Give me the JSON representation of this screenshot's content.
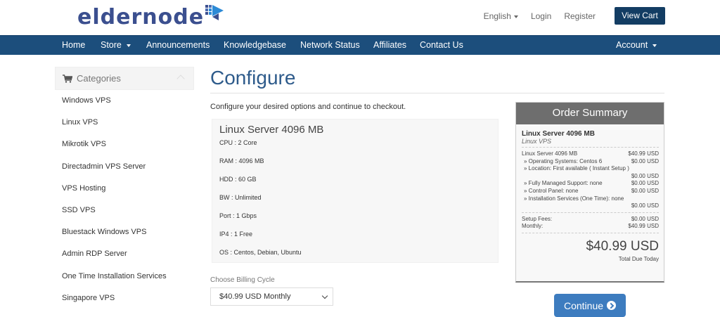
{
  "brand": {
    "logo_text": "eldernode"
  },
  "header": {
    "language": "English",
    "login": "Login",
    "register": "Register",
    "view_cart": "View Cart"
  },
  "nav": {
    "items": [
      "Home",
      "Store",
      "Announcements",
      "Knowledgebase",
      "Network Status",
      "Affiliates",
      "Contact Us"
    ],
    "account": "Account"
  },
  "sidebar": {
    "heading": "Categories",
    "items": [
      "Windows VPS",
      "Linux VPS",
      "Mikrotik VPS",
      "Directadmin VPS Server",
      "VPS Hosting",
      "SSD VPS",
      "Bluestack Windows VPS",
      "Admin RDP Server",
      "One Time Installation Services",
      "Singapore VPS"
    ]
  },
  "main": {
    "title": "Configure",
    "intro": "Configure your desired options and continue to checkout.",
    "product": {
      "name": "Linux Server 4096 MB",
      "specs": [
        "CPU : 2 Core",
        "RAM : 4096 MB",
        "HDD : 60 GB",
        "BW : Unlimited",
        "Port : 1 Gbps",
        "IP4 : 1 Free",
        "OS : Centos, Debian, Ubuntu"
      ]
    },
    "billing": {
      "label": "Choose Billing Cycle",
      "selected": "$40.99 USD Monthly"
    }
  },
  "summary": {
    "heading": "Order Summary",
    "product": "Linux Server 4096 MB",
    "group": "Linux VPS",
    "base": {
      "label": "Linux Server 4096 MB",
      "value": "$40.99 USD"
    },
    "os": {
      "label": "» Operating Systems: Centos 6",
      "value": "$0.00 USD"
    },
    "location": {
      "label": "» Location: First available ( Instant Setup )",
      "value": "$0.00 USD"
    },
    "managed": {
      "label": "» Fully Managed Support: none",
      "value": "$0.00 USD"
    },
    "panel": {
      "label": "» Control Panel: none",
      "value": "$0.00 USD"
    },
    "install": {
      "label": "» Installation Services (One Time): none",
      "value": "$0.00 USD"
    },
    "setup": {
      "label": "Setup Fees:",
      "value": "$0.00 USD"
    },
    "monthly": {
      "label": "Monthly:",
      "value": "$40.99 USD"
    },
    "total": "$40.99 USD",
    "total_label": "Total Due Today"
  },
  "continue_label": "Continue",
  "colors": {
    "nav_bg": "#1c4e7c",
    "cart_btn": "#133d63",
    "title": "#2e5b8b",
    "summary_head": "#6e6e6e",
    "continue_btn": "#3d7cbf"
  }
}
